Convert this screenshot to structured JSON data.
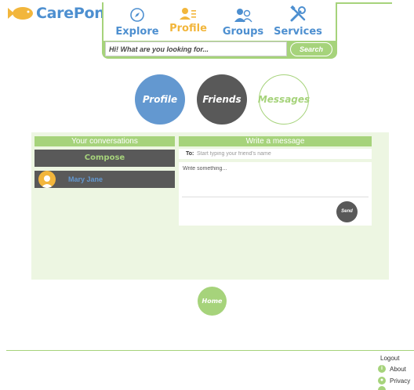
{
  "brand": {
    "name": "CarePond"
  },
  "nav": {
    "items": [
      {
        "label": "Explore",
        "icon": "compass-icon"
      },
      {
        "label": "Profile",
        "icon": "profile-icon",
        "active": true
      },
      {
        "label": "Groups",
        "icon": "groups-icon"
      },
      {
        "label": "Services",
        "icon": "tools-icon"
      }
    ]
  },
  "search": {
    "placeholder": "Hi! What are you looking for...",
    "button_label": "Search"
  },
  "sections": {
    "profile": "Profile",
    "friends": "Friends",
    "messages": "Messages"
  },
  "conversations": {
    "heading": "Your conversations",
    "compose_label": "Compose",
    "items": [
      {
        "name": "Mary Jane"
      }
    ]
  },
  "write": {
    "heading": "Write a message",
    "to_label": "To:",
    "to_placeholder": "Start typing your friend's name",
    "body_placeholder": "Write something...",
    "send_label": "Send"
  },
  "home_label": "Home",
  "footer": {
    "logout": "Logout",
    "about": "About",
    "privacy": "Privacy"
  },
  "colors": {
    "green": "#a6d37b",
    "blue": "#6398d0",
    "dark": "#595959",
    "orange": "#f2b63c"
  }
}
